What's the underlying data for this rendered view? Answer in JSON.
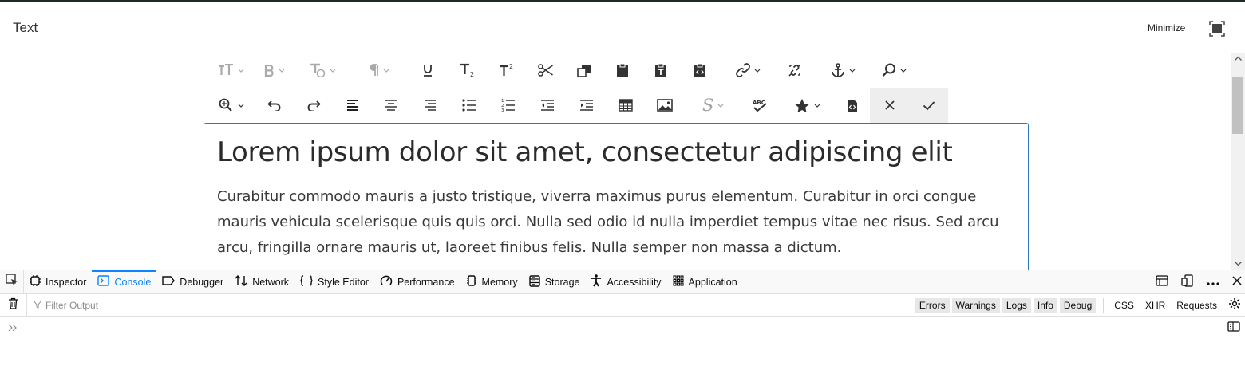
{
  "modal": {
    "title": "Text",
    "minimize_label": "Minimize"
  },
  "toolbar": {
    "row1": [
      "font-size-icon",
      "bold-icon",
      "text-style-icon",
      "paragraph-icon",
      "underline-icon",
      "subscript-icon",
      "superscript-icon",
      "cut-icon",
      "copy-icon",
      "paste-icon",
      "paste-text-icon",
      "paste-code-icon",
      "link-icon",
      "unlink-icon",
      "anchor-icon",
      "find-icon"
    ],
    "row2": [
      "find-replace-icon",
      "undo-icon",
      "redo-icon",
      "align-left-icon",
      "align-center-icon",
      "align-right-icon",
      "bullet-list-icon",
      "numbered-list-icon",
      "outdent-icon",
      "indent-icon",
      "table-icon",
      "image-icon",
      "special-char-icon",
      "spellcheck-icon",
      "star-icon",
      "source-code-icon",
      "cancel-icon",
      "confirm-icon"
    ]
  },
  "editor": {
    "heading": "Lorem ipsum dolor sit amet, consectetur adipiscing elit",
    "paragraph": "Curabitur commodo mauris a justo tristique, viverra maximus purus elementum. Curabitur in orci congue mauris vehicula scelerisque quis quis orci. Nulla sed odio id nulla imperdiet tempus vitae nec risus. Sed arcu arcu, fringilla ornare mauris ut, laoreet finibus felis. Nulla semper non massa a dictum."
  },
  "devtools": {
    "tabs": [
      {
        "label": "Inspector",
        "icon": "inspector-icon"
      },
      {
        "label": "Console",
        "icon": "console-icon",
        "active": true
      },
      {
        "label": "Debugger",
        "icon": "debugger-icon"
      },
      {
        "label": "Network",
        "icon": "network-icon"
      },
      {
        "label": "Style Editor",
        "icon": "style-editor-icon"
      },
      {
        "label": "Performance",
        "icon": "performance-icon"
      },
      {
        "label": "Memory",
        "icon": "memory-icon"
      },
      {
        "label": "Storage",
        "icon": "storage-icon"
      },
      {
        "label": "Accessibility",
        "icon": "accessibility-icon"
      },
      {
        "label": "Application",
        "icon": "application-icon"
      }
    ],
    "filter_placeholder": "Filter Output",
    "levels": [
      "Errors",
      "Warnings",
      "Logs",
      "Info",
      "Debug"
    ],
    "extra_filters": [
      "CSS",
      "XHR",
      "Requests"
    ],
    "accent": "#0a84ff"
  }
}
